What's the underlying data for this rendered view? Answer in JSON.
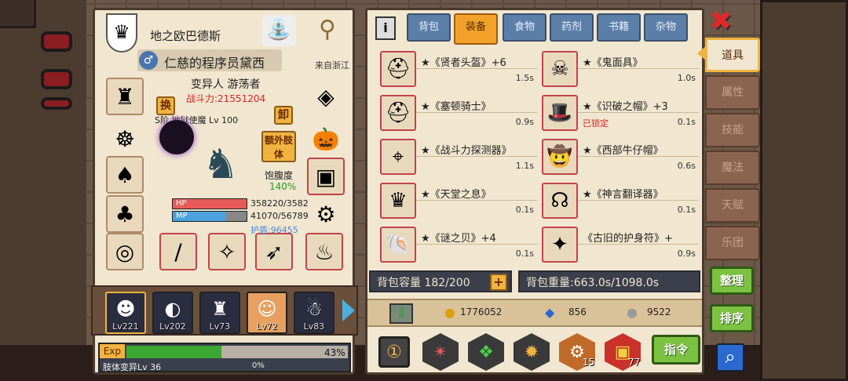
{
  "character": {
    "class_name": "地之欧巴德斯",
    "name": "仁慈的程序员黛西",
    "origin": "来自浙江",
    "species": "变异人 游荡者",
    "power": "战斗力:21551204",
    "swap_label": "换",
    "unequip_label": "卸",
    "extra_limb_label": "额外肢体",
    "pet_info": "S阶 地狱使魔 Lv 100",
    "satiety_label": "饱腹度",
    "satiety_value": "140%",
    "hp_label": "HP",
    "hp_value": "358220/3582",
    "mp_label": "MP",
    "mp_value": "41070/56789",
    "shield": "护盾:96455",
    "exp_label": "Exp",
    "exp_percent": "43%",
    "exp_fill": 0.43,
    "limb_label": "肢体变异Lv 36",
    "limb_percent": "0%"
  },
  "roster": [
    {
      "level": "Lv221",
      "icon": "☻"
    },
    {
      "level": "Lv202",
      "icon": "◐"
    },
    {
      "level": "Lv73",
      "icon": "♜"
    },
    {
      "level": "Lv72",
      "icon": "☺"
    },
    {
      "level": "Lv83",
      "icon": "☃"
    }
  ],
  "tabs": [
    "背包",
    "装备",
    "食物",
    "药剂",
    "书籍",
    "杂物"
  ],
  "active_tab": "装备",
  "info_icon": "i",
  "items": [
    {
      "name": "★《贤者头盔》+6",
      "weight": "1.5s",
      "icon": "⛑"
    },
    {
      "name": "★《鬼面具》",
      "weight": "1.0s",
      "icon": "☠"
    },
    {
      "name": "★《塞顿骑士》",
      "weight": "0.9s",
      "icon": "⛑"
    },
    {
      "name": "★《识破之帽》+3",
      "weight": "0.1s",
      "icon": "🎩",
      "locked": "已锁定"
    },
    {
      "name": "★《战斗力探测器》",
      "weight": "1.1s",
      "icon": "⌖"
    },
    {
      "name": "★《西部牛仔帽》",
      "weight": "0.6s",
      "icon": "🤠"
    },
    {
      "name": "★《天堂之息》",
      "weight": "0.1s",
      "icon": "♛"
    },
    {
      "name": "★《神言翻译器》",
      "weight": "0.1s",
      "icon": "☊"
    },
    {
      "name": "★《谜之贝》+4",
      "weight": "0.1s",
      "icon": "🐚"
    },
    {
      "name": "《古旧的护身符》+",
      "weight": "0.9s",
      "icon": "✦"
    }
  ],
  "bag_capacity": "背包容量 182/200",
  "bag_weight": "背包重量:663.0s/1098.0s",
  "currency": {
    "gold": "1776052",
    "gem": "856",
    "silver": "9522"
  },
  "bottom_icons": [
    {
      "icon": "①",
      "count": ""
    },
    {
      "icon": "✴",
      "count": ""
    },
    {
      "icon": "❖",
      "count": ""
    },
    {
      "icon": "✹",
      "count": ""
    },
    {
      "icon": "⚙",
      "count": "15"
    },
    {
      "icon": "▣",
      "count": "77"
    }
  ],
  "command_label": "指令",
  "side_tabs": [
    "道具",
    "属性",
    "技能",
    "魔法",
    "天赋",
    "乐团"
  ],
  "sort_label": "整理",
  "order_label": "排序",
  "close_icon": "✖",
  "search_icon": "⌕",
  "colors": {
    "accent": "#f2a22a",
    "hp": "#e85a5a",
    "mp": "#4aa2e0",
    "exp": "#3aa832"
  }
}
